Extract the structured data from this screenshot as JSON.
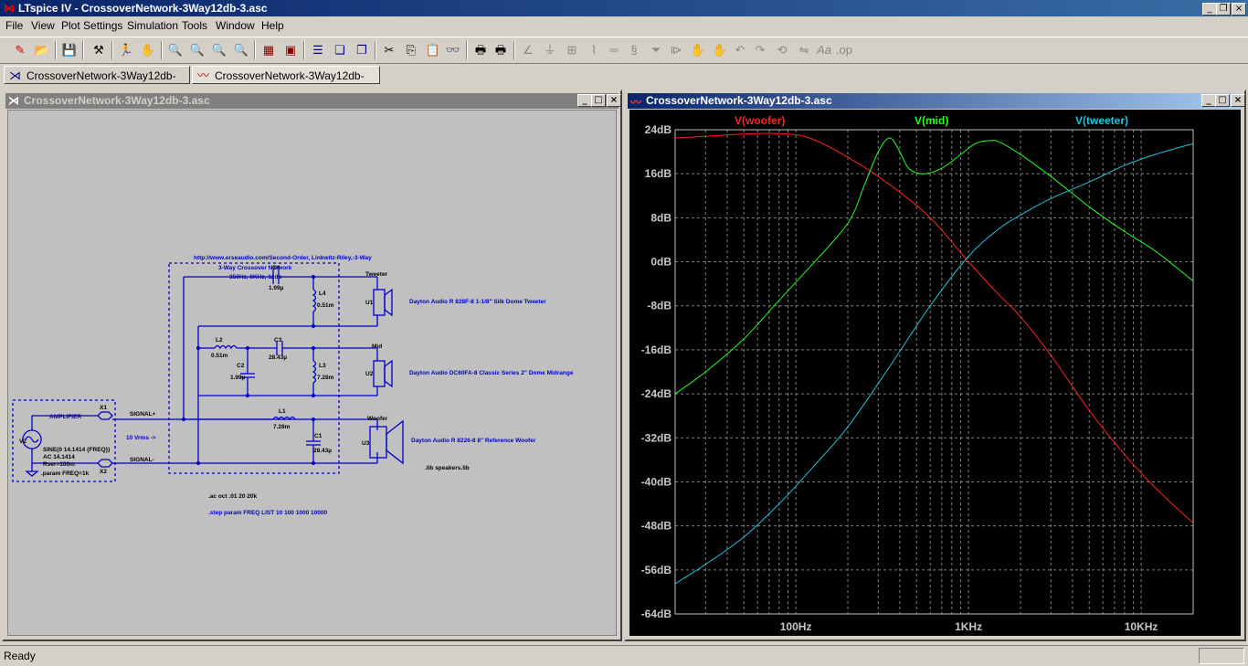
{
  "app": {
    "title": "LTspice IV - CrossoverNetwork-3Way12db-3.asc"
  },
  "menu": [
    "File",
    "View",
    "Plot Settings",
    "Simulation",
    "Tools",
    "Window",
    "Help"
  ],
  "tabs": [
    {
      "label": "CrossoverNetwork-3Way12db-3.asc",
      "icon": "schematic-icon"
    },
    {
      "label": "CrossoverNetwork-3Way12db-3.asc",
      "icon": "waveform-icon"
    }
  ],
  "schematic_window": {
    "title": "CrossoverNetwork-3Way12db-3.asc"
  },
  "plot_window": {
    "title": "CrossoverNetwork-3Way12db-3.asc"
  },
  "schematic": {
    "url": "http://www.erseaudio.com/Second-Order, Linkwitz-Riley,-3-Way",
    "heading1": "3-Way Crossover Network",
    "heading2": "350Hz, 6KHz, 12db",
    "amplifier": "AMPLIFIER",
    "v2": "V2",
    "sine": "SINE(0 14.1414 {FREQ})",
    "ac": "AC 14.1414",
    "rser": "Rser=100m",
    "param": ".param FREQ=1k",
    "x1": "X1",
    "x2": "X2",
    "signal_plus": "SIGNAL+",
    "signal_minus": "SIGNAL-",
    "vrms": "10 Vrms ->",
    "c4": "C4",
    "c4v": "1.99µ",
    "l4": "L4",
    "l4v": "0.51m",
    "l2": "L2",
    "l2v": "0.51m",
    "c3": "C3",
    "c3v": "28.43µ",
    "c2": "C2",
    "c2v": "1.99µ",
    "l3": "L3",
    "l3v": "7.28m",
    "l1": "L1",
    "l1v": "7.28m",
    "c1": "C1",
    "c1v": "28.43µ",
    "tweeter": "Tweeter",
    "u1": "U1",
    "tweeter_desc": "Dayton Audio R 828F-8 1-1/8\" Silk Dome Tweeter",
    "mid": "Mid",
    "u2": "U2",
    "mid_desc": "Dayton Audio DC60FA-8 Classic Series 2\" Dome Midrange",
    "woofer": "Woofer",
    "u3": "U3",
    "woofer_desc": "Dayton Audio R 8226-8 8\" Reference Woofer",
    "lib": ".lib speakers.lib",
    "ac_cmd": ".ac oct .01 20 20k",
    "step_cmd": ".step param FREQ LIST 10 100 1000 10000"
  },
  "chart_data": {
    "type": "line",
    "x_scale": "log",
    "xlim": [
      20,
      20000
    ],
    "ylim": [
      -64,
      24
    ],
    "yticks": [
      "24dB",
      "16dB",
      "8dB",
      "0dB",
      "-8dB",
      "-16dB",
      "-24dB",
      "-32dB",
      "-40dB",
      "-48dB",
      "-56dB",
      "-64dB"
    ],
    "ytick_values": [
      24,
      16,
      8,
      0,
      -8,
      -16,
      -24,
      -32,
      -40,
      -48,
      -56,
      -64
    ],
    "xticks": [
      "100Hz",
      "1KHz",
      "10KHz"
    ],
    "xtick_values": [
      100,
      1000,
      10000
    ],
    "grid": true,
    "series": [
      {
        "name": "V(woofer)",
        "color": "#ff2020",
        "x": [
          20,
          30,
          50,
          80,
          120,
          200,
          350,
          600,
          1000,
          1500,
          2000,
          3000,
          5000,
          8000,
          12000,
          20000
        ],
        "y": [
          22.5,
          22.8,
          23.2,
          23.3,
          22.5,
          19,
          14,
          8,
          0,
          -6,
          -10,
          -17,
          -27,
          -35,
          -41,
          -47.5
        ]
      },
      {
        "name": "V(mid)",
        "color": "#20ff20",
        "x": [
          20,
          30,
          50,
          80,
          120,
          200,
          250,
          300,
          350,
          400,
          450,
          550,
          700,
          900,
          1100,
          1300,
          1500,
          2000,
          3000,
          5000,
          8000,
          12000,
          20000
        ],
        "y": [
          -24,
          -20,
          -14,
          -7,
          -1,
          7,
          14,
          20,
          22.5,
          20,
          17,
          16,
          17,
          19.5,
          21.5,
          22,
          21.8,
          19.5,
          15.5,
          10,
          5.5,
          2,
          -3.5
        ]
      },
      {
        "name": "V(tweeter)",
        "color": "#20c0e0",
        "x": [
          20,
          30,
          50,
          80,
          120,
          200,
          350,
          600,
          1000,
          1500,
          2000,
          3000,
          5000,
          8000,
          12000,
          20000
        ],
        "y": [
          -58.5,
          -55,
          -50,
          -44,
          -38,
          -30,
          -19,
          -8,
          1,
          6,
          8.5,
          11.5,
          14.5,
          17.5,
          19.5,
          21.5
        ]
      }
    ]
  },
  "status": {
    "text": "Ready"
  }
}
